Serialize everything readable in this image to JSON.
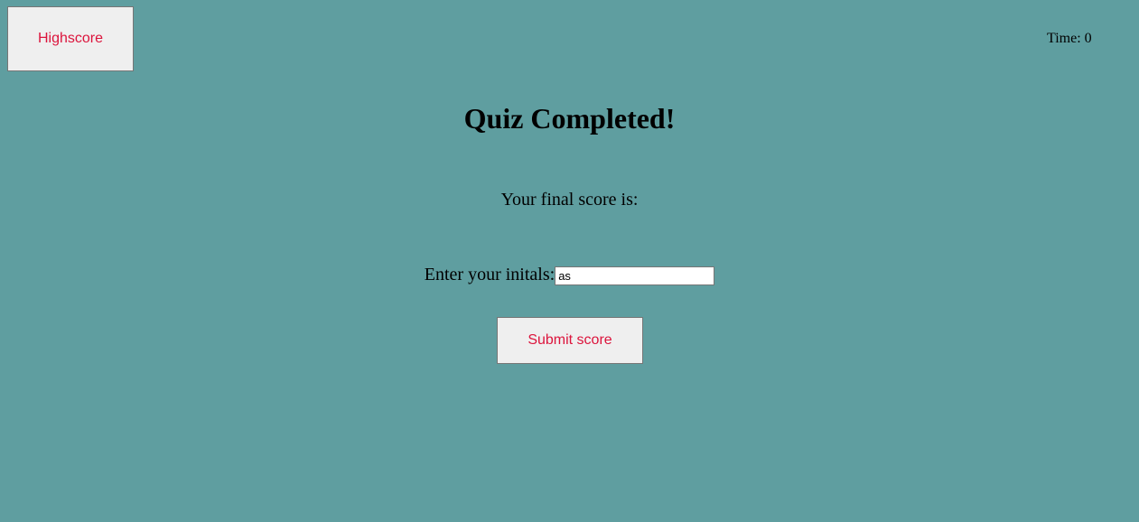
{
  "header": {
    "highscore_label": "Highscore",
    "timer_text": "Time: 0"
  },
  "main": {
    "title": "Quiz Completed!",
    "final_score_text": "Your final score is:",
    "initials_label": "Enter your initals:",
    "initials_value": "as",
    "submit_label": "Submit score"
  },
  "colors": {
    "background": "#5f9ea0",
    "button_text": "#dc143c",
    "button_bg": "#efefef"
  }
}
